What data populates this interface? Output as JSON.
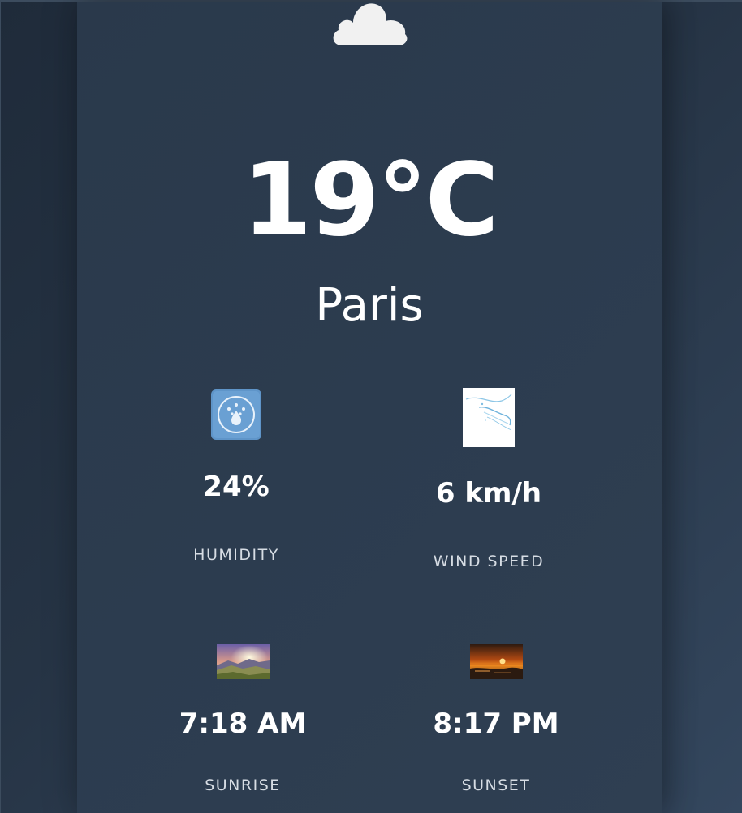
{
  "weather": {
    "condition_icon": "cloud-icon",
    "temperature": "19°C",
    "city": "Paris"
  },
  "stats": {
    "humidity": {
      "value": "24%",
      "label": "HUMIDITY",
      "icon": "humidity-icon"
    },
    "wind": {
      "value": "6 km/h",
      "label": "WIND SPEED",
      "icon": "wind-icon"
    },
    "sunrise": {
      "value": "7:18 AM",
      "label": "SUNRISE",
      "icon": "sunrise-image"
    },
    "sunset": {
      "value": "8:17 PM",
      "label": "SUNSET",
      "icon": "sunset-image"
    }
  },
  "colors": {
    "background": "#263445",
    "card": "#2c3c4f",
    "text": "#ffffff",
    "label": "#d7dde4"
  }
}
